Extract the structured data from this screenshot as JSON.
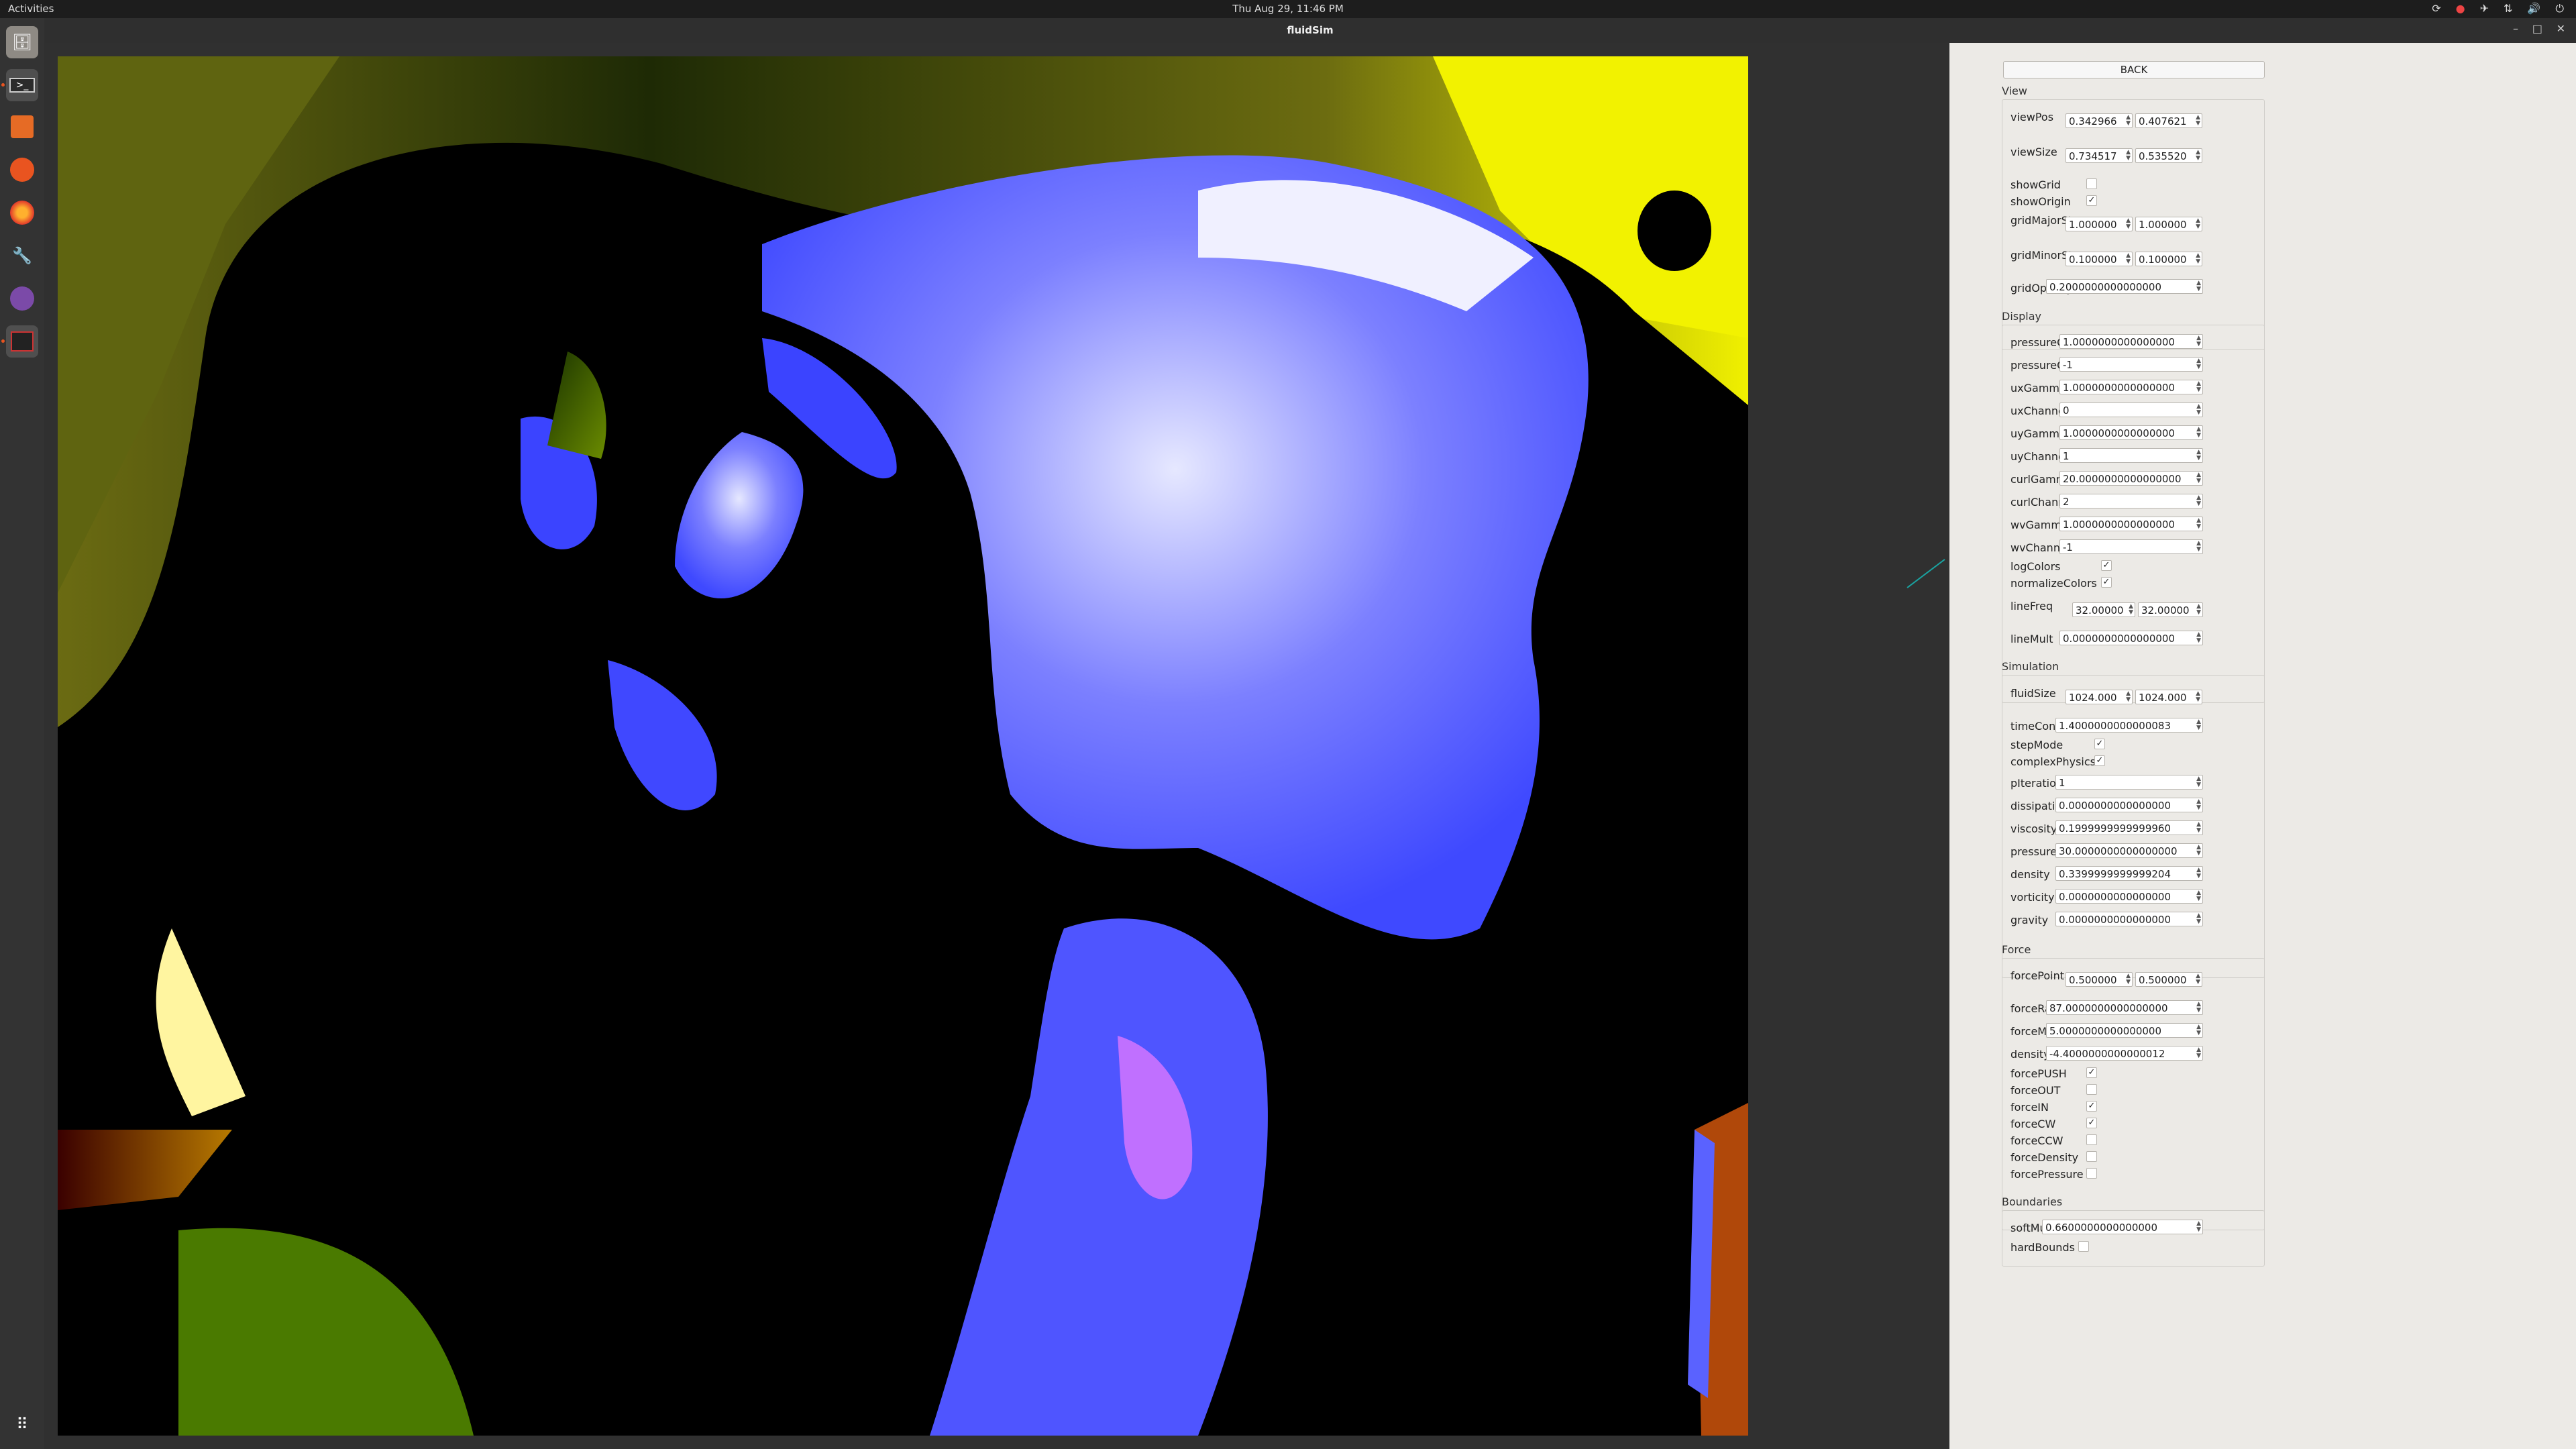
{
  "topbar": {
    "activities": "Activities",
    "clock": "Thu Aug 29, 11:46 PM"
  },
  "dock": {
    "icons": [
      "files-icon",
      "terminal-icon",
      "calculator-icon",
      "software-center-icon",
      "firefox-icon",
      "tools-icon",
      "emacs-icon",
      "screenshot-app-icon",
      "show-apps-icon"
    ]
  },
  "window": {
    "title": "fluidSim"
  },
  "panel": {
    "back_label": "BACK",
    "view": {
      "section": "View",
      "viewPos": {
        "label": "viewPos",
        "x": "0.342966",
        "y": "0.407621"
      },
      "viewSize": {
        "label": "viewSize",
        "x": "0.734517",
        "y": "0.535520"
      },
      "showGrid": {
        "label": "showGrid",
        "checked": false
      },
      "showOrigin": {
        "label": "showOrigin",
        "checked": true
      },
      "gridMajorStep": {
        "label": "gridMajorStep",
        "x": "1.000000",
        "y": "1.000000"
      },
      "gridMinorStep": {
        "label": "gridMinorStep",
        "x": "0.100000",
        "y": "0.100000"
      },
      "gridOpacity": {
        "label": "gridOpacity",
        "value": "0.2000000000000000"
      }
    },
    "display": {
      "section": "Display",
      "pressureGamma": {
        "label": "pressureGamma",
        "value": "1.0000000000000000"
      },
      "pressureChannel": {
        "label": "pressureChannel",
        "value": "-1"
      },
      "uxGamma": {
        "label": "uxGamma",
        "value": "1.0000000000000000"
      },
      "uxChannel": {
        "label": "uxChannel",
        "value": "0"
      },
      "uyGamma": {
        "label": "uyGamma",
        "value": "1.0000000000000000"
      },
      "uyChannel": {
        "label": "uyChannel",
        "value": "1"
      },
      "curlGamma": {
        "label": "curlGamma",
        "value": "20.0000000000000000"
      },
      "curlChannel": {
        "label": "curlChannel",
        "value": "2"
      },
      "wvGamma": {
        "label": "wvGamma",
        "value": "1.0000000000000000"
      },
      "wvChannel": {
        "label": "wvChannel",
        "value": "-1"
      },
      "logColors": {
        "label": "logColors",
        "checked": true
      },
      "normalizeColors": {
        "label": "normalizeColors",
        "checked": true
      },
      "lineFreq": {
        "label": "lineFreq",
        "x": "32.00000",
        "y": "32.00000"
      },
      "lineMult": {
        "label": "lineMult",
        "value": "0.0000000000000000"
      }
    },
    "simulation": {
      "section": "Simulation",
      "fluidSize": {
        "label": "fluidSize",
        "x": "1024.000",
        "y": "1024.000"
      },
      "timeConstant": {
        "label": "timeConstant",
        "value": "1.4000000000000083"
      },
      "stepMode": {
        "label": "stepMode",
        "checked": true
      },
      "complexPhysics": {
        "label": "complexPhysics",
        "checked": true
      },
      "pIterations": {
        "label": "pIterations",
        "value": "1"
      },
      "dissipation": {
        "label": "dissipation",
        "value": "0.0000000000000000"
      },
      "viscosity": {
        "label": "viscosity",
        "value": "0.1999999999999960"
      },
      "pressure": {
        "label": "pressure",
        "value": "30.0000000000000000"
      },
      "density": {
        "label": "density",
        "value": "0.3399999999999204"
      },
      "vorticity": {
        "label": "vorticity",
        "value": "0.0000000000000000"
      },
      "gravity": {
        "label": "gravity",
        "value": "0.0000000000000000"
      }
    },
    "force": {
      "section": "Force",
      "forcePoint": {
        "label": "forcePoint",
        "x": "0.500000",
        "y": "0.500000"
      },
      "forceRadius": {
        "label": "forceRadius",
        "value": "87.0000000000000000"
      },
      "forceMag": {
        "label": "forceMag",
        "value": "5.0000000000000000"
      },
      "densityMag": {
        "label": "densityMag",
        "value": "-4.4000000000000012"
      },
      "forcePUSH": {
        "label": "forcePUSH",
        "checked": true
      },
      "forceOUT": {
        "label": "forceOUT",
        "checked": false
      },
      "forceIN": {
        "label": "forceIN",
        "checked": true
      },
      "forceCW": {
        "label": "forceCW",
        "checked": true
      },
      "forceCCW": {
        "label": "forceCCW",
        "checked": false
      },
      "forceDensity": {
        "label": "forceDensity",
        "checked": false
      },
      "forcePressure": {
        "label": "forcePressure",
        "checked": false
      }
    },
    "boundaries": {
      "section": "Boundaries",
      "softMult": {
        "label": "softMult",
        "value": "0.6600000000000000"
      },
      "hardBounds": {
        "label": "hardBounds",
        "checked": false
      }
    }
  }
}
